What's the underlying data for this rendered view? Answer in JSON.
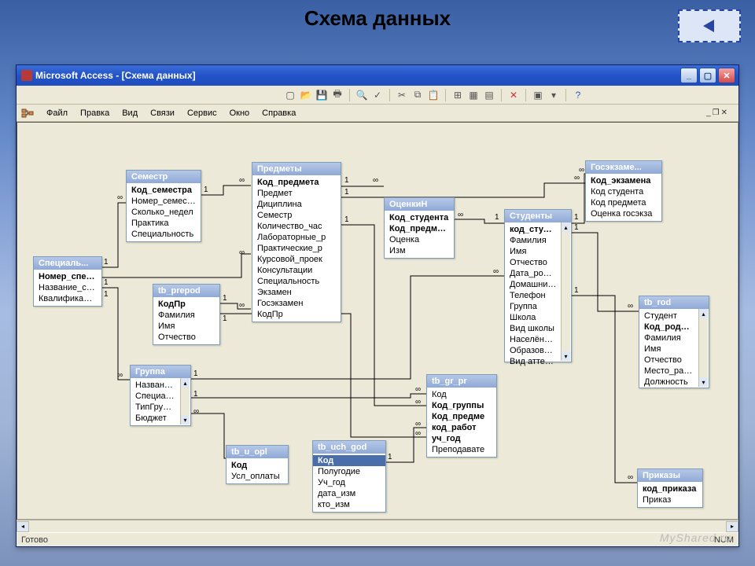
{
  "page_title": "Схема данных",
  "window_title": "Microsoft Access - [Схема данных]",
  "menu": [
    "Файл",
    "Правка",
    "Вид",
    "Связи",
    "Сервис",
    "Окно",
    "Справка"
  ],
  "status": {
    "ready": "Готово",
    "num": "NUM"
  },
  "watermark": "MyShared.ru",
  "tables": {
    "special": {
      "title": "Специаль...",
      "fields": [
        {
          "n": "Номер_специал",
          "pk": true
        },
        {
          "n": "Название_специ"
        },
        {
          "n": "Квалификация"
        }
      ]
    },
    "semestr": {
      "title": "Семестр",
      "fields": [
        {
          "n": "Код_семестра",
          "pk": true
        },
        {
          "n": "Номер_семестра"
        },
        {
          "n": "Сколько_недел"
        },
        {
          "n": "Практика"
        },
        {
          "n": "Специальность"
        }
      ]
    },
    "predmety": {
      "title": "Предметы",
      "fields": [
        {
          "n": "Код_предмета",
          "pk": true
        },
        {
          "n": "Предмет"
        },
        {
          "n": "Дициплина"
        },
        {
          "n": "Семестр"
        },
        {
          "n": "Количество_час"
        },
        {
          "n": "Лабораторные_р"
        },
        {
          "n": "Практические_р"
        },
        {
          "n": "Курсовой_проек"
        },
        {
          "n": "Консультации"
        },
        {
          "n": "Специальность"
        },
        {
          "n": "Экзамен"
        },
        {
          "n": "Госэкзамен"
        },
        {
          "n": "КодПр"
        }
      ]
    },
    "ocenkin": {
      "title": "ОценкиН",
      "fields": [
        {
          "n": "Код_студента",
          "pk": true
        },
        {
          "n": "Код_предмета",
          "pk": true
        },
        {
          "n": "Оценка"
        },
        {
          "n": "Изм"
        }
      ]
    },
    "studenty": {
      "title": "Студенты",
      "fields": [
        {
          "n": "код_студент",
          "pk": true
        },
        {
          "n": "Фамилия"
        },
        {
          "n": "Имя"
        },
        {
          "n": "Отчество"
        },
        {
          "n": "Дата_рожде"
        },
        {
          "n": "Домашний_а"
        },
        {
          "n": "Телефон"
        },
        {
          "n": "Группа"
        },
        {
          "n": "Школа"
        },
        {
          "n": "Вид школы"
        },
        {
          "n": "Населённый"
        },
        {
          "n": "Образование"
        },
        {
          "n": "Вид аттеста"
        }
      ]
    },
    "gosexam": {
      "title": "Госэкзаме...",
      "fields": [
        {
          "n": "Код_экзамена",
          "pk": true
        },
        {
          "n": "Код студента"
        },
        {
          "n": "Код предмета"
        },
        {
          "n": "Оценка госэкза"
        }
      ]
    },
    "tb_rod": {
      "title": "tb_rod",
      "fields": [
        {
          "n": "Студент"
        },
        {
          "n": "Код_родител",
          "pk": true
        },
        {
          "n": "Фамилия"
        },
        {
          "n": "Имя"
        },
        {
          "n": "Отчество"
        },
        {
          "n": "Место_работ"
        },
        {
          "n": "Должность"
        }
      ]
    },
    "tb_prepod": {
      "title": "tb_prepod",
      "fields": [
        {
          "n": "КодПр",
          "pk": true
        },
        {
          "n": "Фамилия"
        },
        {
          "n": "Имя"
        },
        {
          "n": "Отчество"
        }
      ]
    },
    "gruppa": {
      "title": "Группа",
      "fields": [
        {
          "n": "Название_гр"
        },
        {
          "n": "Специальнос"
        },
        {
          "n": "ТипГруппы"
        },
        {
          "n": "Бюджет"
        }
      ]
    },
    "tb_u_opl": {
      "title": "tb_u_opl",
      "fields": [
        {
          "n": "Код",
          "pk": true
        },
        {
          "n": "Усл_оплаты"
        }
      ]
    },
    "tb_uch_god": {
      "title": "tb_uch_god",
      "fields": [
        {
          "n": "Код",
          "pk": true,
          "sel": true
        },
        {
          "n": "Полугодие"
        },
        {
          "n": "Уч_год"
        },
        {
          "n": "дата_изм"
        },
        {
          "n": "кто_изм"
        }
      ]
    },
    "tb_gr_pr": {
      "title": "tb_gr_pr",
      "fields": [
        {
          "n": "Код"
        },
        {
          "n": "Код_группы",
          "pk": true
        },
        {
          "n": "Код_предме",
          "pk": true
        },
        {
          "n": "код_работ",
          "pk": true
        },
        {
          "n": "уч_год",
          "pk": true
        },
        {
          "n": "Преподавате"
        }
      ]
    },
    "prikazy": {
      "title": "Приказы",
      "fields": [
        {
          "n": "код_приказа",
          "pk": true
        },
        {
          "n": "Приказ"
        }
      ]
    }
  },
  "cardinality": {
    "one": "1",
    "many": "∞"
  },
  "chart_data": {
    "type": "table",
    "description": "Entity-relationship diagram (MS Access Relationships window). Boxes are tables, lines are relations with 1/∞ cardinality.",
    "entities": [
      "Специаль...",
      "Семестр",
      "Предметы",
      "ОценкиН",
      "Студенты",
      "Госэкзаме...",
      "tb_rod",
      "tb_prepod",
      "Группа",
      "tb_u_opl",
      "tb_uch_god",
      "tb_gr_pr",
      "Приказы"
    ],
    "relations": [
      {
        "from": "Специаль...",
        "to": "Семестр",
        "card": "1:∞"
      },
      {
        "from": "Специаль...",
        "to": "Предметы",
        "card": "1:∞"
      },
      {
        "from": "Специаль...",
        "to": "Группа",
        "card": "1:∞"
      },
      {
        "from": "Семестр",
        "to": "Предметы",
        "card": "1:∞"
      },
      {
        "from": "tb_prepod",
        "to": "Предметы",
        "card": "1:∞"
      },
      {
        "from": "tb_prepod",
        "to": "tb_gr_pr",
        "card": "1:∞"
      },
      {
        "from": "Предметы",
        "to": "ОценкиН",
        "card": "1:∞"
      },
      {
        "from": "Предметы",
        "to": "tb_gr_pr",
        "card": "1:∞"
      },
      {
        "from": "Предметы",
        "to": "Госэкзаме...",
        "card": "1:∞"
      },
      {
        "from": "Студенты",
        "to": "ОценкиН",
        "card": "1:∞"
      },
      {
        "from": "Студенты",
        "to": "Госэкзаме...",
        "card": "1:∞"
      },
      {
        "from": "Студенты",
        "to": "tb_rod",
        "card": "1:∞"
      },
      {
        "from": "Студенты",
        "to": "Приказы",
        "card": "1:∞"
      },
      {
        "from": "Группа",
        "to": "Студенты",
        "card": "1:∞"
      },
      {
        "from": "Группа",
        "to": "tb_gr_pr",
        "card": "1:∞"
      },
      {
        "from": "tb_u_opl",
        "to": "Группа",
        "card": "∞:1"
      },
      {
        "from": "tb_uch_god",
        "to": "tb_gr_pr",
        "card": "1:∞"
      }
    ]
  }
}
